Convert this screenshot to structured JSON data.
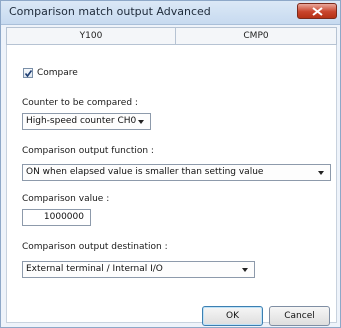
{
  "window": {
    "title": "Comparison match output Advanced",
    "close_label": "×"
  },
  "tabs": [
    {
      "label": "Y100"
    },
    {
      "label": "CMP0"
    }
  ],
  "compare": {
    "checked": true,
    "label": "Compare"
  },
  "counter": {
    "label": "Counter to be compared :",
    "value": "High-speed counter CH0"
  },
  "output_function": {
    "label": "Comparison output function :",
    "value": "ON when elapsed value is smaller than setting value"
  },
  "comparison_value": {
    "label": "Comparison value :",
    "value": "1000000"
  },
  "output_destination": {
    "label": "Comparison output destination :",
    "value": "External terminal / Internal I/O"
  },
  "buttons": {
    "ok": "OK",
    "cancel": "Cancel"
  }
}
